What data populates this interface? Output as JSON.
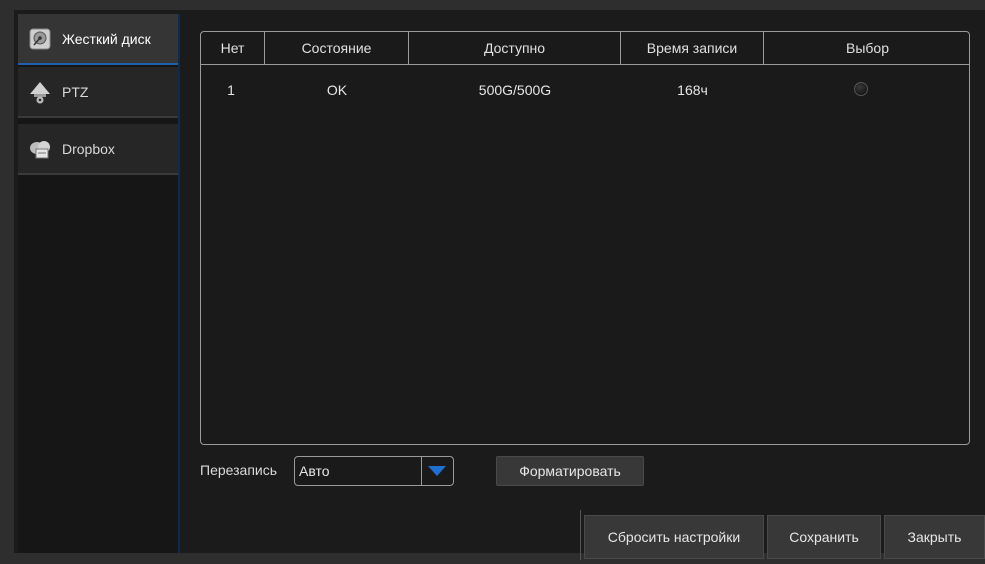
{
  "sidebar": {
    "items": [
      {
        "label": "Жесткий диск",
        "icon": "hard-disk-icon",
        "active": true
      },
      {
        "label": "PTZ",
        "icon": "ptz-camera-icon",
        "active": false
      },
      {
        "label": "Dropbox",
        "icon": "dropbox-cloud-icon",
        "active": false
      }
    ]
  },
  "table": {
    "columns": [
      "Нет",
      "Состояние",
      "Доступно",
      "Время записи",
      "Выбор"
    ],
    "rows": [
      {
        "no": "1",
        "status": "OK",
        "available": "500G/500G",
        "record_time": "168ч",
        "selected": false
      }
    ]
  },
  "overwrite": {
    "label": "Перезапись",
    "value": "Авто"
  },
  "buttons": {
    "format": "Форматировать",
    "reset": "Сбросить настройки",
    "save": "Сохранить",
    "close": "Закрыть"
  },
  "colors": {
    "accent": "#1f5fb0",
    "background": "#1b1b1b",
    "border": "#9a9a9a"
  }
}
